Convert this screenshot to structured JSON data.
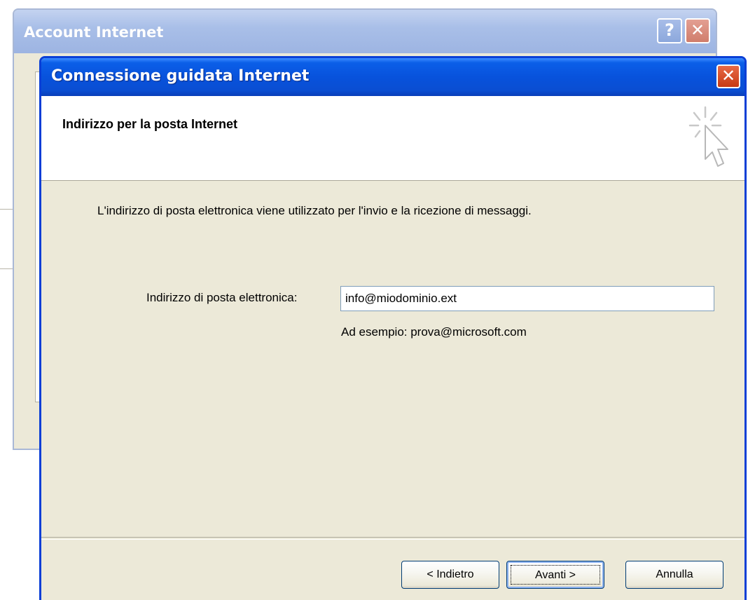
{
  "background_window": {
    "title": "Account Internet",
    "help_button": "?",
    "close_button": "✕"
  },
  "wizard": {
    "title": "Connessione guidata Internet",
    "close_button": "✕",
    "header_title": "Indirizzo per la posta Internet",
    "header_icon": "wizard-cursor-icon",
    "description": "L'indirizzo di posta elettronica viene utilizzato per l'invio e la ricezione di messaggi.",
    "email_label": "Indirizzo di posta elettronica:",
    "email_value": "info@miodominio.ext",
    "email_hint": "Ad esempio: prova@microsoft.com",
    "buttons": {
      "back": "< Indietro",
      "next": "Avanti >",
      "cancel": "Annulla"
    }
  },
  "colors": {
    "titlebar_active": "#0852dc",
    "dialog_face": "#ece9d8",
    "close_red": "#c73a14"
  }
}
